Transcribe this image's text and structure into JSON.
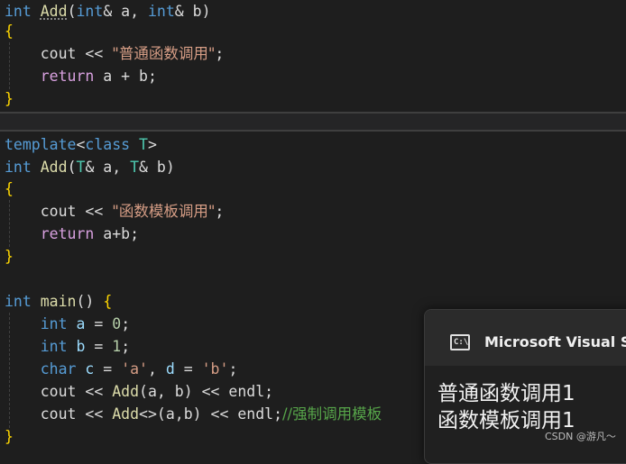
{
  "code": {
    "l1": {
      "kw": "int",
      "fn": "Add",
      "p1": "(",
      "t1": "int",
      "p2": "& a, ",
      "t2": "int",
      "p3": "& b)"
    },
    "l2": {
      "brace": "{"
    },
    "l3": {
      "pre": "cout << ",
      "str": "\"普通函数调用\"",
      "post": ";"
    },
    "l4": {
      "kw": "return",
      "rest": " a + b;"
    },
    "l5": {
      "brace": "}"
    },
    "l6": {
      "kw1": "template",
      "p1": "<",
      "kw2": "class",
      "tp": " T",
      "p2": ">"
    },
    "l7": {
      "kw": "int",
      "fn": "Add",
      "p1": "(",
      "tp1": "T",
      "p2": "& a, ",
      "tp2": "T",
      "p3": "& b)"
    },
    "l8": {
      "brace": "{"
    },
    "l9": {
      "pre": "cout << ",
      "str": "\"函数模板调用\"",
      "post": ";"
    },
    "l10": {
      "kw": "return",
      "rest": " a+b;"
    },
    "l11": {
      "brace": "}"
    },
    "l12": {
      "kw": "int",
      "fn": "main",
      "rest": "() ",
      "brace": "{"
    },
    "l13": {
      "kw": "int",
      "var": " a",
      "eq": " = ",
      "num": "0",
      "end": ";"
    },
    "l14": {
      "kw": "int",
      "var": " b",
      "eq": " = ",
      "num": "1",
      "end": ";"
    },
    "l15": {
      "kw": "char",
      "var1": " c",
      "eq1": " = ",
      "s1": "'a'",
      "sep": ", ",
      "var2": "d",
      "eq2": " = ",
      "s2": "'b'",
      "end": ";"
    },
    "l16": {
      "pre": "cout << ",
      "fn": "Add",
      "args": "(a, b)",
      "post": " << endl;"
    },
    "l17": {
      "pre": "cout << ",
      "fn": "Add",
      "targs": "<>",
      "args": "(a,b)",
      "post": " << endl;",
      "cmt": "//强制调用模板"
    },
    "l18": {
      "brace": "}"
    }
  },
  "toast": {
    "icon": "console-app-icon",
    "icon_text": "C:\\",
    "title": "Microsoft Visual St",
    "output_line1": "普通函数调用1",
    "output_line2": "函数模板调用1"
  },
  "watermark": "CSDN @游凡～",
  "colors": {
    "background": "#1e1e1e",
    "keyword": "#569cd6",
    "function": "#dcdcaa",
    "string": "#d69d85",
    "control": "#d8a0df",
    "number": "#b5cea8",
    "type": "#4ec9b0",
    "comment": "#57a64a",
    "brace": "#ffd700"
  }
}
